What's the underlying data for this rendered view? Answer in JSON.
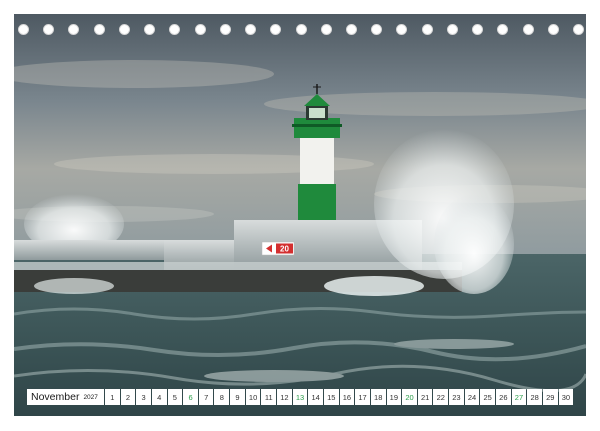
{
  "calendar": {
    "month": "November",
    "year": "2027",
    "days": [
      {
        "n": "1",
        "hl": false
      },
      {
        "n": "2",
        "hl": false
      },
      {
        "n": "3",
        "hl": false
      },
      {
        "n": "4",
        "hl": false
      },
      {
        "n": "5",
        "hl": false
      },
      {
        "n": "6",
        "hl": true
      },
      {
        "n": "7",
        "hl": false
      },
      {
        "n": "8",
        "hl": false
      },
      {
        "n": "9",
        "hl": false
      },
      {
        "n": "10",
        "hl": false
      },
      {
        "n": "11",
        "hl": false
      },
      {
        "n": "12",
        "hl": false
      },
      {
        "n": "13",
        "hl": true
      },
      {
        "n": "14",
        "hl": false
      },
      {
        "n": "15",
        "hl": false
      },
      {
        "n": "16",
        "hl": false
      },
      {
        "n": "17",
        "hl": false
      },
      {
        "n": "18",
        "hl": false
      },
      {
        "n": "19",
        "hl": false
      },
      {
        "n": "20",
        "hl": true
      },
      {
        "n": "21",
        "hl": false
      },
      {
        "n": "22",
        "hl": false
      },
      {
        "n": "23",
        "hl": false
      },
      {
        "n": "24",
        "hl": false
      },
      {
        "n": "25",
        "hl": false
      },
      {
        "n": "26",
        "hl": false
      },
      {
        "n": "27",
        "hl": true
      },
      {
        "n": "28",
        "hl": false
      },
      {
        "n": "29",
        "hl": false
      },
      {
        "n": "30",
        "hl": false
      }
    ],
    "weekend_color": "#2a9d4a"
  },
  "photo": {
    "pier_sign": "20",
    "lighthouse_color": "#1f8a3c",
    "sky_color": "#6f7c85",
    "sea_color": "#3f5a5e"
  },
  "binding": {
    "hole_count": 23
  }
}
